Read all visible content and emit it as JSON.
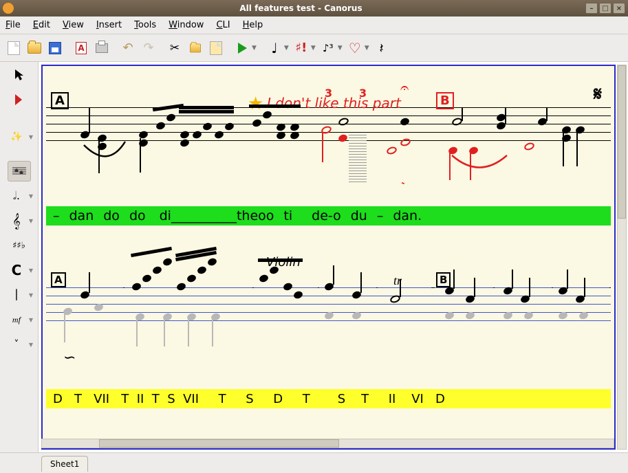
{
  "window": {
    "title": "All features test - Canorus"
  },
  "menu": {
    "file": "File",
    "edit": "Edit",
    "view": "View",
    "insert": "Insert",
    "tools": "Tools",
    "window": "Window",
    "cli": "CLI",
    "help": "Help"
  },
  "toolbar": {
    "new": "New",
    "open": "Open",
    "save": "Save",
    "pdf": "Export PDF",
    "print": "Print",
    "undo": "Undo",
    "redo": "Redo",
    "cut": "Cut",
    "copy": "Copy",
    "paste": "Paste",
    "play": "Play",
    "note": "Note duration",
    "accidental": "Accidental",
    "tuplet": "Tuplet",
    "slur": "Slur",
    "rest": "Rest"
  },
  "sidebar": {
    "select": "Select",
    "insert": "Insert mode",
    "fx": "Effects",
    "staff": "Staff view",
    "duration": "Duration",
    "clef": "Clef",
    "keysig": "Key signature",
    "timesig": "Time signature",
    "barline": "Barline",
    "dynamics": "Dynamics",
    "hairpin": "Hairpin"
  },
  "score": {
    "rehearsal_a": "A",
    "rehearsal_b": "B",
    "annotation": "I don't like this part",
    "instrument": "Violin",
    "trill": "tr",
    "lyrics_top": [
      "–",
      "dan",
      "do",
      "do",
      "di__________theoo",
      "ti",
      "de-o",
      "du",
      "–",
      "dan."
    ],
    "lyrics_bottom": "D   T   VII   T  II  T  S  VII     T     S     D     T       S    T     II    VI   D",
    "segno": "𝄋"
  },
  "tabs": {
    "sheet1": "Sheet1"
  },
  "colors": {
    "accent_blue": "#2a28c8",
    "canvas_bg": "#fbf8e3",
    "lyric_green": "#1ddd1d",
    "lyric_yellow": "#ffff2b",
    "note_red": "#e02020"
  }
}
